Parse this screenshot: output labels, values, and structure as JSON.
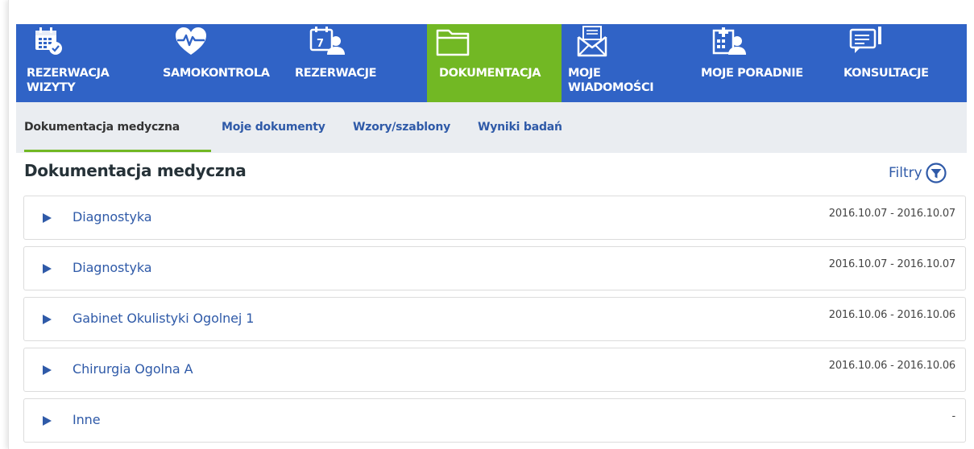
{
  "colors": {
    "nav_bg": "#3063c6",
    "nav_active_bg": "#72b824",
    "subnav_bg": "#eaedf1",
    "link_blue": "#2f5aa8",
    "accent_green": "#72b824"
  },
  "nav": {
    "items": [
      {
        "label_line1": "REZERWACJA",
        "label_line2": "WIZYTY",
        "icon": "calendar-check-icon",
        "active": false
      },
      {
        "label_line1": "SAMOKONTROLA",
        "label_line2": "",
        "icon": "heart-pulse-icon",
        "active": false
      },
      {
        "label_line1": "REZERWACJE",
        "label_line2": "",
        "icon": "calendar-person-icon",
        "active": false
      },
      {
        "label_line1": "DOKUMENTACJA",
        "label_line2": "",
        "icon": "folder-icon",
        "active": true
      },
      {
        "label_line1": "MOJE",
        "label_line2": "WIADOMOŚCI",
        "icon": "envelope-icon",
        "active": false
      },
      {
        "label_line1": "MOJE PORADNIE",
        "label_line2": "",
        "icon": "hospital-person-icon",
        "active": false
      },
      {
        "label_line1": "KONSULTACJE",
        "label_line2": "",
        "icon": "chat-bubble-icon",
        "active": false
      }
    ]
  },
  "subnav": {
    "tabs": [
      {
        "label": "Dokumentacja medyczna",
        "active": true
      },
      {
        "label": "Moje dokumenty",
        "active": false
      },
      {
        "label": "Wzory/szablony",
        "active": false
      },
      {
        "label": "Wyniki badań",
        "active": false
      }
    ]
  },
  "main": {
    "title": "Dokumentacja medyczna",
    "filters_label": "Filtry",
    "filters_icon": "filter-icon",
    "rows": [
      {
        "name": "Diagnostyka",
        "date": "2016.10.07 - 2016.10.07"
      },
      {
        "name": "Diagnostyka",
        "date": "2016.10.07 - 2016.10.07"
      },
      {
        "name": "Gabinet Okulistyki Ogolnej 1",
        "date": "2016.10.06 - 2016.10.06"
      },
      {
        "name": "Chirurgia Ogolna A",
        "date": "2016.10.06 - 2016.10.06"
      },
      {
        "name": "Inne",
        "date": "-"
      }
    ]
  }
}
